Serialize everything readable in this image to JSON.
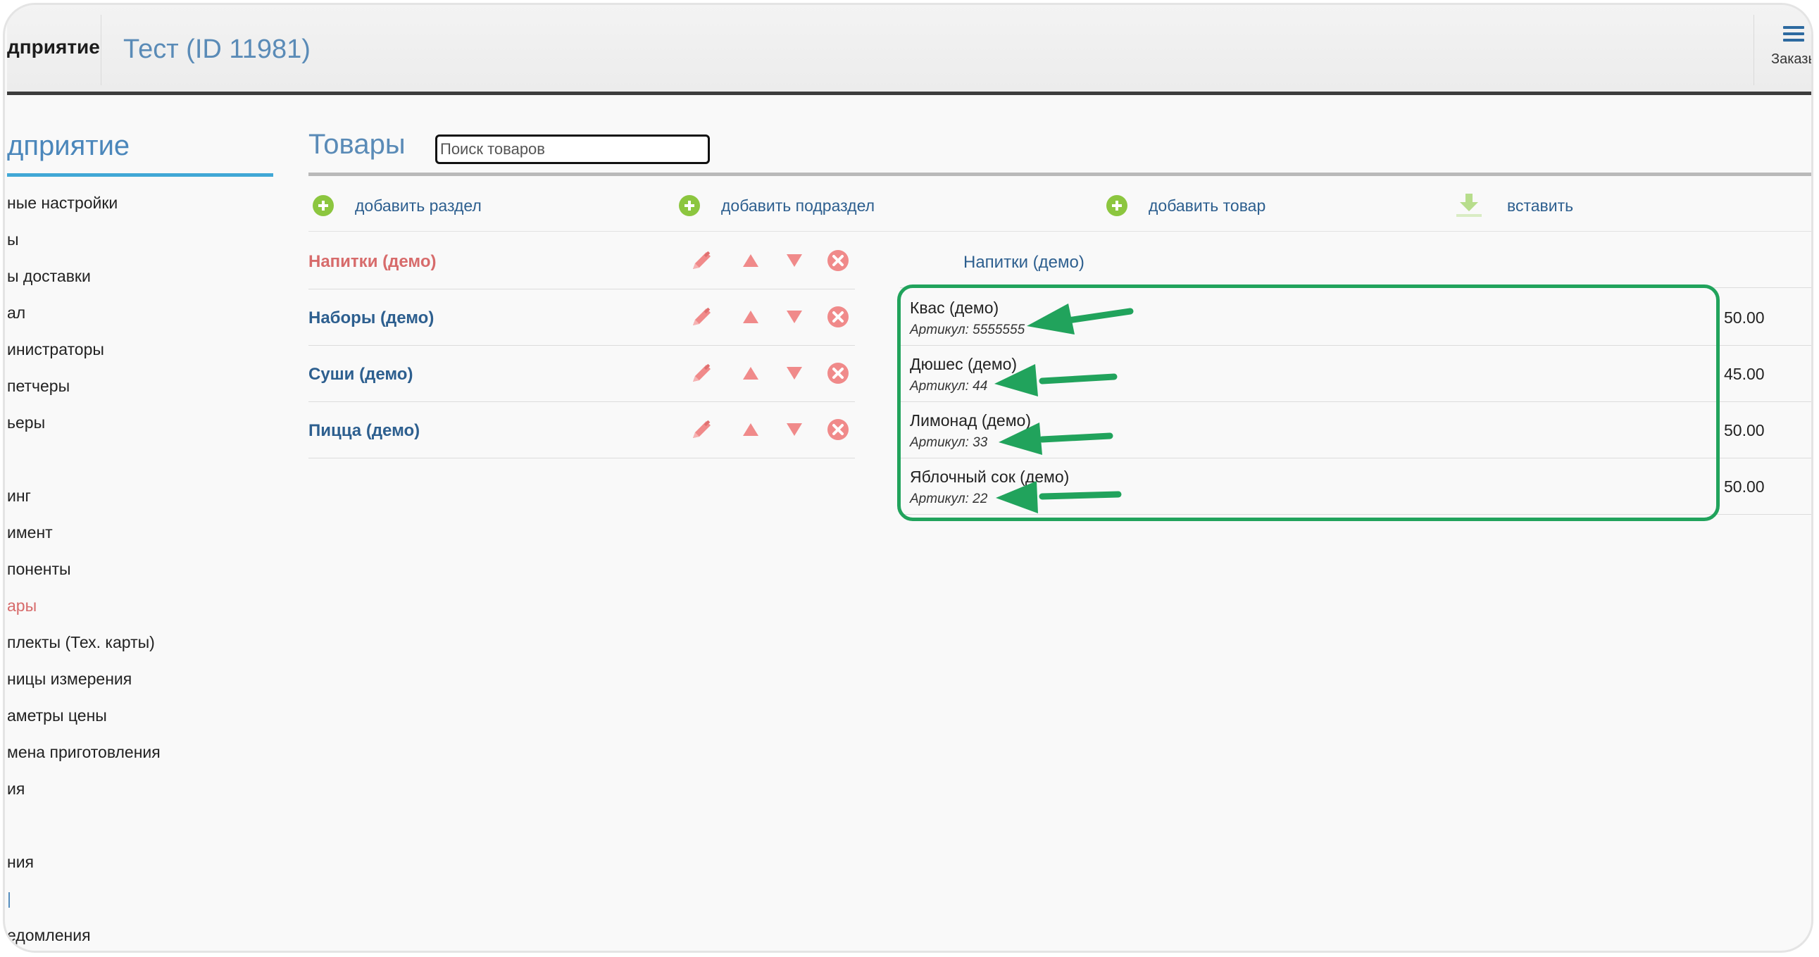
{
  "header": {
    "brand": "дприятие",
    "title": "Тест (ID 11981)",
    "orders_label": "Заказы"
  },
  "sidebar": {
    "title": "дприятие",
    "items": [
      {
        "label": "ные настройки",
        "state": "normal"
      },
      {
        "label": "ы",
        "state": "normal"
      },
      {
        "label": "ы доставки",
        "state": "normal"
      },
      {
        "label": "ал",
        "state": "normal"
      },
      {
        "label": "инистраторы",
        "state": "normal"
      },
      {
        "label": "петчеры",
        "state": "normal"
      },
      {
        "label": "ьеры",
        "state": "normal"
      },
      {
        "label": "инг",
        "state": "normal"
      },
      {
        "label": "имент",
        "state": "normal"
      },
      {
        "label": "поненты",
        "state": "normal"
      },
      {
        "label": "ары",
        "state": "active"
      },
      {
        "label": "плекты (Тех. карты)",
        "state": "normal"
      },
      {
        "label": "ницы измерения",
        "state": "normal"
      },
      {
        "label": "аметры цены",
        "state": "normal"
      },
      {
        "label": "мена приготовления",
        "state": "normal"
      },
      {
        "label": "ия",
        "state": "normal"
      },
      {
        "label": "ния",
        "state": "normal"
      },
      {
        "label": "|",
        "state": "link"
      },
      {
        "label": "едомления",
        "state": "normal"
      }
    ]
  },
  "main": {
    "title": "Товары",
    "search_placeholder": "Поиск товаров",
    "toolbar": {
      "add_section": "добавить раздел",
      "add_subsection": "добавить подраздел",
      "add_product": "добавить товар",
      "paste": "вставить"
    },
    "categories": [
      {
        "name": "Напитки (демо)",
        "active": true
      },
      {
        "name": "Наборы (демо)",
        "active": false
      },
      {
        "name": "Суши (демо)",
        "active": false
      },
      {
        "name": "Пицца (демо)",
        "active": false
      }
    ],
    "products_header": "Напитки (демо)",
    "products": [
      {
        "name": "Квас (демо)",
        "sku": "Артикул: 5555555",
        "price": "50.00"
      },
      {
        "name": "Дюшес (демо)",
        "sku": "Артикул: 44",
        "price": "45.00"
      },
      {
        "name": "Лимонад (демо)",
        "sku": "Артикул: 33",
        "price": "50.00"
      },
      {
        "name": "Яблочный сок (демо)",
        "sku": "Артикул: 22",
        "price": "50.00"
      }
    ]
  },
  "colors": {
    "accent_blue": "#4b87bb",
    "link_blue": "#2d5f8f",
    "active_red": "#d76b6b",
    "add_green": "#8cc63f",
    "highlight_green": "#21a35c",
    "action_pink": "#f08a8a"
  }
}
